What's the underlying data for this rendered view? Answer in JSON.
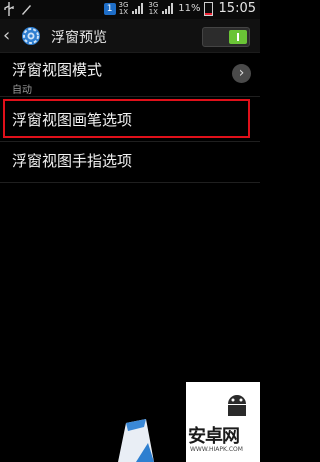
{
  "status_bar": {
    "sim_badge": "1",
    "network_top": "3G",
    "network_bottom": "1X",
    "network2_top": "3G",
    "network2_bottom": "1X",
    "battery_pct": "11%",
    "time": "15:05"
  },
  "action_bar": {
    "title": "浮窗预览",
    "back_icon": "back-arrow-icon",
    "settings_icon": "gear-icon",
    "switch_on": true
  },
  "list": {
    "item1": {
      "title": "浮窗视图模式",
      "subtitle": "自动"
    },
    "item2": {
      "title": "浮窗视图画笔选项"
    },
    "item3": {
      "title": "浮窗视图手指选项"
    }
  },
  "watermark": {
    "text": "安卓网",
    "url": "WWW.HIAPK.COM"
  },
  "colors": {
    "highlight": "#e0101a",
    "switch_on": "#6ac436",
    "background": "#000000"
  }
}
